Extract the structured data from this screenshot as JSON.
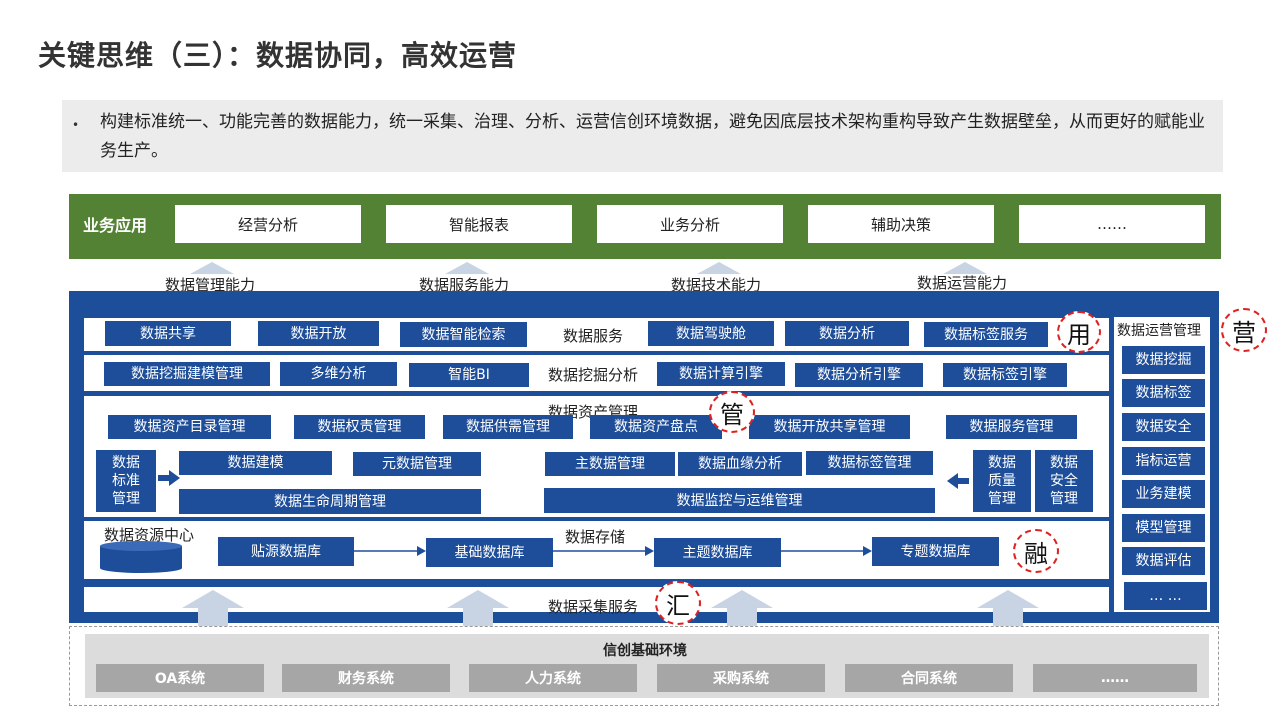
{
  "title": "关键思维（三）：数据协同，高效运营",
  "intro": {
    "bullet": "•",
    "text": "构建标准统一、功能完善的数据能力，统一采集、治理、分析、运营信创环境数据，避免因底层技术架构重构导致产生数据壁垒，从而更好的赋能业务生产。"
  },
  "business": {
    "label": "业务应用",
    "items": [
      "经营分析",
      "智能报表",
      "业务分析",
      "辅助决策",
      "……"
    ]
  },
  "capabilities": [
    "数据管理能力",
    "数据服务能力",
    "数据技术能力",
    "数据运营能力"
  ],
  "service_row": {
    "label": "数据服务",
    "items": [
      "数据共享",
      "数据开放",
      "数据智能检索",
      "数据驾驶舱",
      "数据分析",
      "数据标签服务"
    ]
  },
  "mining_row": {
    "label": "数据挖掘分析",
    "items": [
      "数据挖掘建模管理",
      "多维分析",
      "智能BI",
      "数据计算引擎",
      "数据分析引擎",
      "数据标签引擎"
    ]
  },
  "asset": {
    "label": "数据资产管理",
    "top_items": [
      "数据资产目录管理",
      "数据权责管理",
      "数据供需管理",
      "数据资产盘点",
      "数据开放共享管理",
      "数据服务管理"
    ],
    "standard": "数据\n标准\n管理",
    "quality": "数据\n质量\n管理",
    "security": "数据\n安全\n管理",
    "modeling": "数据建模",
    "metadata": "元数据管理",
    "master": "主数据管理",
    "lineage": "数据血缘分析",
    "tag_mgmt": "数据标签管理",
    "lifecycle": "数据生命周期管理",
    "monitor": "数据监控与运维管理"
  },
  "storage": {
    "center": "数据资源中心",
    "label": "数据存储",
    "items": [
      "贴源数据库",
      "基础数据库",
      "主题数据库",
      "专题数据库"
    ]
  },
  "collection": {
    "label": "数据采集服务"
  },
  "ops": {
    "title": "数据运营管理",
    "items": [
      "数据挖掘",
      "数据标签",
      "数据安全",
      "指标运营",
      "业务建模",
      "模型管理",
      "数据评估",
      "… …"
    ]
  },
  "markers": {
    "use": "用",
    "manage": "管",
    "fuse": "融",
    "gather": "汇",
    "operate": "营"
  },
  "foundation": {
    "title": "信创基础环境",
    "items": [
      "OA系统",
      "财务系统",
      "人力系统",
      "采购系统",
      "合同系统",
      "……"
    ]
  },
  "colors": {
    "business_green": "#548235",
    "platform_blue": "#1e4e9a",
    "marker_red": "#dd2222",
    "foundation_gray": "#a6a6a6"
  }
}
